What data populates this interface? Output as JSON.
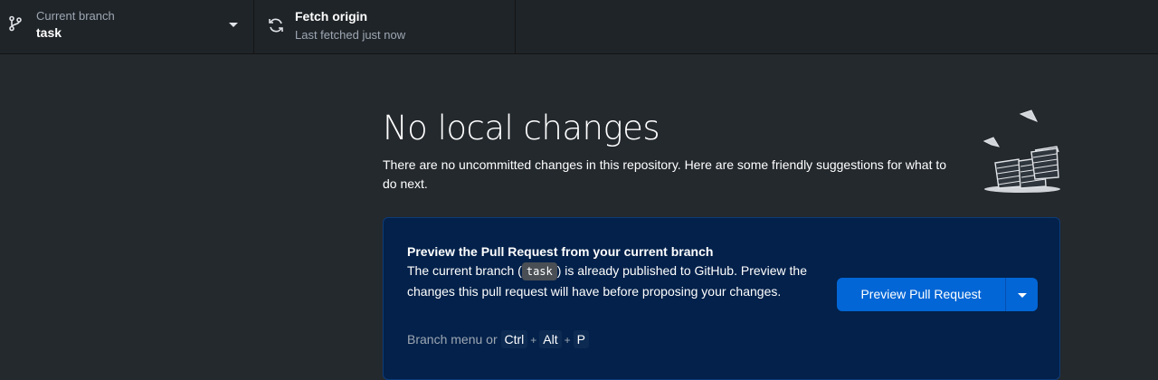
{
  "toolbar": {
    "branch": {
      "label": "Current branch",
      "name": "task",
      "icon": "git-branch-icon"
    },
    "fetch": {
      "label": "Fetch origin",
      "status": "Last fetched just now",
      "icon": "sync-icon"
    }
  },
  "main": {
    "title": "No local changes",
    "description": "There are no uncommitted changes in this repository. Here are some friendly suggestions for what to do next.",
    "illustration": "paper-stack-illustration"
  },
  "card": {
    "title": "Preview the Pull Request from your current branch",
    "desc_before": "The current branch (",
    "branch_code": "task",
    "desc_after": ") is already published to GitHub. Preview the changes this pull request will have before proposing your changes.",
    "hint_prefix": "Branch menu or",
    "keys": [
      "Ctrl",
      "Alt",
      "P"
    ],
    "plus": "+",
    "button_label": "Preview Pull Request"
  },
  "colors": {
    "background": "#24292e",
    "toolbar": "#1f2428",
    "card": "#03214a",
    "accent": "#0366d6"
  }
}
